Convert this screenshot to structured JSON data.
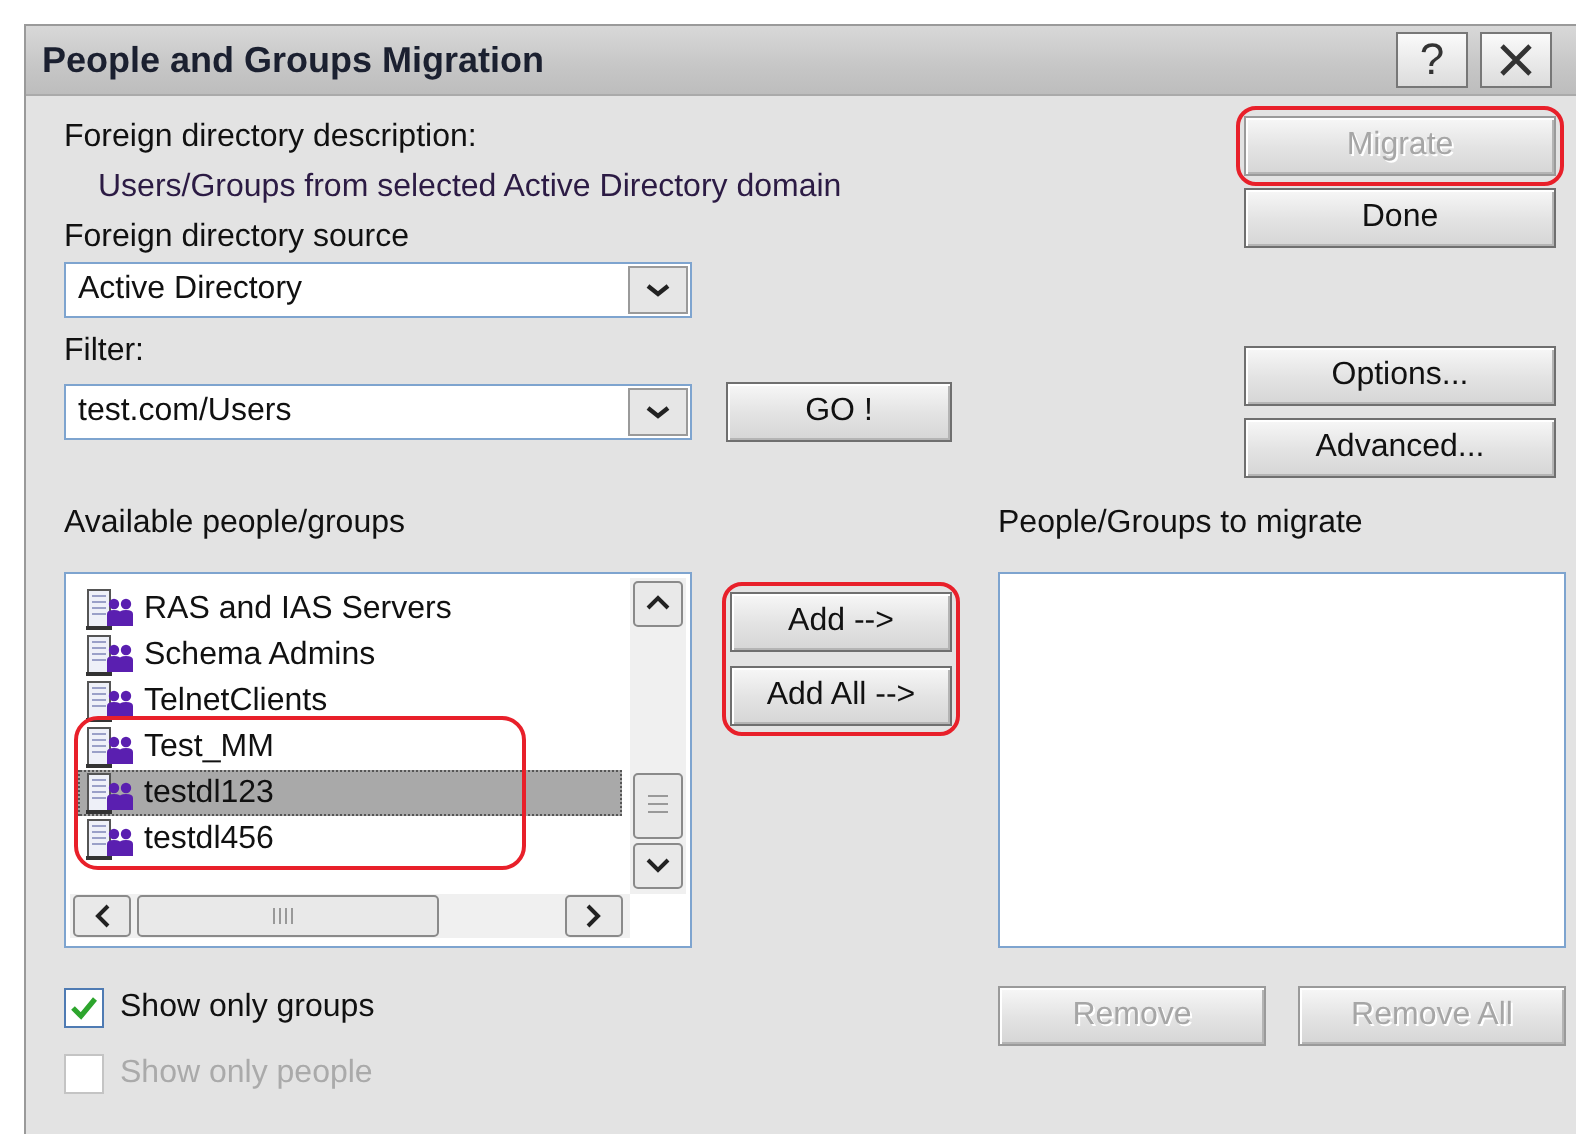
{
  "window": {
    "title": "People and Groups Migration"
  },
  "help_button": {
    "label": "?"
  },
  "description": {
    "label": "Foreign directory description:",
    "value": "Users/Groups from selected Active Directory domain"
  },
  "source": {
    "label": "Foreign directory source",
    "value": "Active Directory"
  },
  "filter": {
    "label": "Filter:",
    "value": "test.com/Users"
  },
  "go_button": {
    "label": "GO !",
    "disabled": false
  },
  "action_buttons": [
    {
      "label": "Migrate",
      "disabled": true,
      "highlighted": true
    },
    {
      "label": "Done",
      "disabled": false,
      "highlighted": false
    }
  ],
  "setting_buttons": [
    {
      "label": "Options...",
      "disabled": false
    },
    {
      "label": "Advanced...",
      "disabled": false
    }
  ],
  "available": {
    "label": "Available people/groups",
    "items": [
      {
        "name": "RAS and IAS Servers",
        "selected": false,
        "highlighted": false
      },
      {
        "name": "Schema Admins",
        "selected": false,
        "highlighted": false
      },
      {
        "name": "TelnetClients",
        "selected": false,
        "highlighted": false
      },
      {
        "name": "Test_MM",
        "selected": false,
        "highlighted": true
      },
      {
        "name": "testdl123",
        "selected": true,
        "highlighted": true
      },
      {
        "name": "testdl456",
        "selected": false,
        "highlighted": true
      }
    ]
  },
  "transfer_buttons": {
    "highlighted": true,
    "buttons": [
      {
        "label": "Add -->",
        "disabled": false
      },
      {
        "label": "Add All -->",
        "disabled": false
      }
    ]
  },
  "to_migrate": {
    "label": "People/Groups to migrate"
  },
  "remove_buttons": [
    {
      "label": "Remove",
      "disabled": true
    },
    {
      "label": "Remove All",
      "disabled": true
    }
  ],
  "checkboxes": [
    {
      "label": "Show only groups",
      "checked": true,
      "disabled": false
    },
    {
      "label": "Show only people",
      "checked": false,
      "disabled": true
    }
  ]
}
